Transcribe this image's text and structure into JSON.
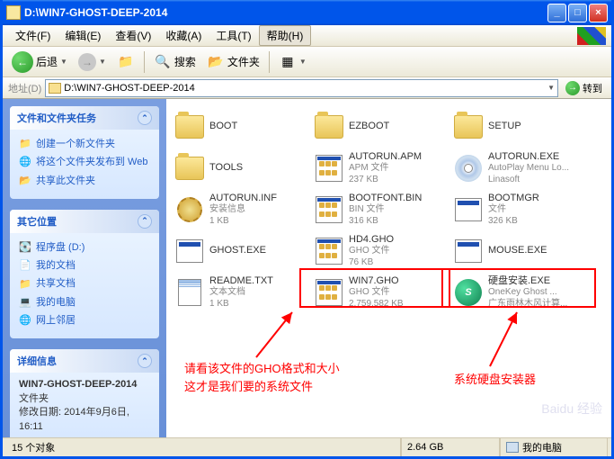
{
  "titlebar": {
    "title": "D:\\WIN7-GHOST-DEEP-2014"
  },
  "menu": {
    "file": "文件(F)",
    "edit": "编辑(E)",
    "view": "查看(V)",
    "fav": "收藏(A)",
    "tools": "工具(T)",
    "help": "帮助(H)"
  },
  "toolbar": {
    "back": "后退",
    "search": "搜索",
    "folders": "文件夹"
  },
  "address": {
    "label": "地址(D)",
    "path": "D:\\WIN7-GHOST-DEEP-2014",
    "go": "转到"
  },
  "sidebar": {
    "tasks": {
      "title": "文件和文件夹任务",
      "items": [
        "创建一个新文件夹",
        "将这个文件夹发布到 Web",
        "共享此文件夹"
      ]
    },
    "other": {
      "title": "其它位置",
      "items": [
        "程序盘 (D:)",
        "我的文档",
        "共享文档",
        "我的电脑",
        "网上邻居"
      ]
    },
    "details": {
      "title": "详细信息",
      "name": "WIN7-GHOST-DEEP-2014",
      "type": "文件夹",
      "modified_label": "修改日期:",
      "modified": "2014年9月6日, 16:11"
    }
  },
  "files": [
    {
      "name": "BOOT",
      "type": "folder"
    },
    {
      "name": "EZBOOT",
      "type": "folder"
    },
    {
      "name": "SETUP",
      "type": "folder"
    },
    {
      "name": "TOOLS",
      "type": "folder"
    },
    {
      "name": "AUTORUN.APM",
      "meta1": "APM 文件",
      "meta2": "237 KB",
      "type": "app"
    },
    {
      "name": "AUTORUN.EXE",
      "meta1": "AutoPlay Menu Lo...",
      "meta2": "Linasoft",
      "type": "disc"
    },
    {
      "name": "AUTORUN.INF",
      "meta1": "安装信息",
      "meta2": "1 KB",
      "type": "gear"
    },
    {
      "name": "BOOTFONT.BIN",
      "meta1": "BIN 文件",
      "meta2": "316 KB",
      "type": "app"
    },
    {
      "name": "BOOTMGR",
      "meta1": "文件",
      "meta2": "326 KB",
      "type": "exe"
    },
    {
      "name": "GHOST.EXE",
      "meta1": "",
      "meta2": "",
      "type": "exe"
    },
    {
      "name": "HD4.GHO",
      "meta1": "GHO 文件",
      "meta2": "76 KB",
      "type": "app"
    },
    {
      "name": "MOUSE.EXE",
      "meta1": "",
      "meta2": "",
      "type": "exe"
    },
    {
      "name": "README.TXT",
      "meta1": "文本文档",
      "meta2": "1 KB",
      "type": "txt"
    },
    {
      "name": "WIN7.GHO",
      "meta1": "GHO 文件",
      "meta2": "2,759,582 KB",
      "type": "app"
    },
    {
      "name": "硬盘安装.EXE",
      "meta1": "OneKey Ghost ...",
      "meta2": "广东雨林木风计算...",
      "type": "green"
    }
  ],
  "annotations": {
    "a1_line1": "请看该文件的GHO格式和大小",
    "a1_line2": "这才是我们要的系统文件",
    "a2": "系统硬盘安装器"
  },
  "status": {
    "count": "15 个对象",
    "size": "2.64 GB",
    "location": "我的电脑"
  },
  "watermark": "Baidu 经验"
}
